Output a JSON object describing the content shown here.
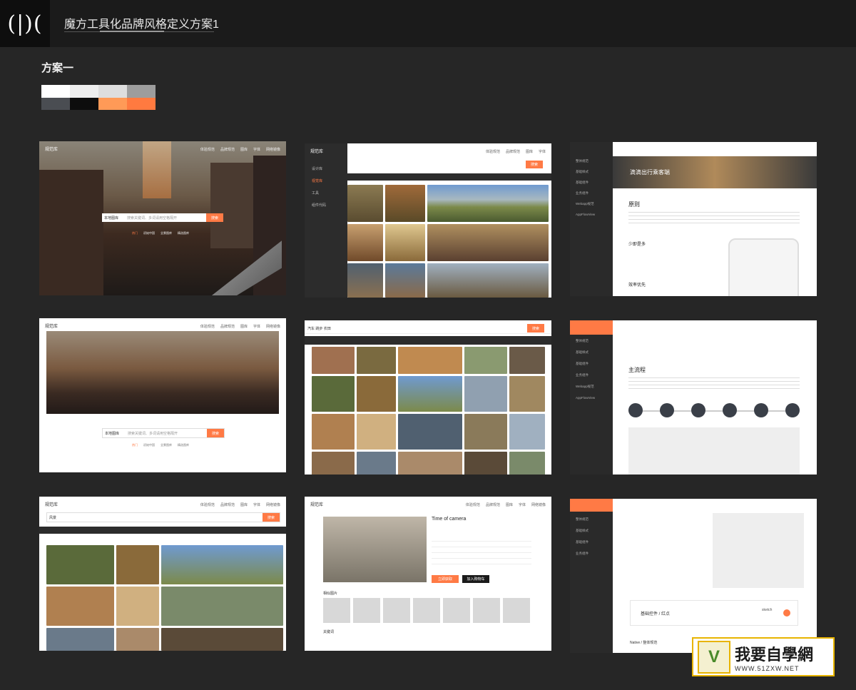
{
  "header": {
    "logo_glyph": "(|)(",
    "title": "魔方工具化品牌风格定义方案1"
  },
  "section": {
    "title": "方案一"
  },
  "palette": [
    "#ffffff",
    "#eeeeee",
    "#dedede",
    "#9d9d9d",
    "#4a4d52",
    "#0d0d0d",
    "#ff9a57",
    "#ff7a40"
  ],
  "thumbs": {
    "nav_items": [
      "体验规范",
      "品牌规范",
      "图库",
      "字体",
      "网络镜像"
    ],
    "brand": "规范库",
    "search_placeholder": "搜索关键词、多词请用空格隔开",
    "search_btn": "搜索",
    "search_select": "本地图库",
    "hot_tags": [
      "热门",
      "初始中国",
      "全景图库",
      "精选图库"
    ],
    "sidebar_items": [
      "设计库",
      "视觉库",
      "工具",
      "组件代码"
    ],
    "hero_text": "滴滴出行乘客端",
    "principle_title": "原则",
    "sub1": "少即是多",
    "sub2": "效率优先",
    "main_flow": "主流程",
    "query": "汽车 跳步 农田",
    "query2": "风景",
    "product_title": "Time of camera",
    "btn_download": "立即获取",
    "btn_cart": "加入购物车",
    "related": "相似图片",
    "keywords": "关键词",
    "basic_component": "基础控件 / 红点",
    "sketch": "sketch",
    "native": "Native / 整体规范",
    "ds_sidebar": [
      "整体规范",
      "基础样式",
      "基础组件",
      "业务组件",
      "Webapp规范",
      "AppFlowView"
    ]
  },
  "watermark": {
    "text": "我要自學網",
    "url": "WWW.51ZXW.NET"
  }
}
